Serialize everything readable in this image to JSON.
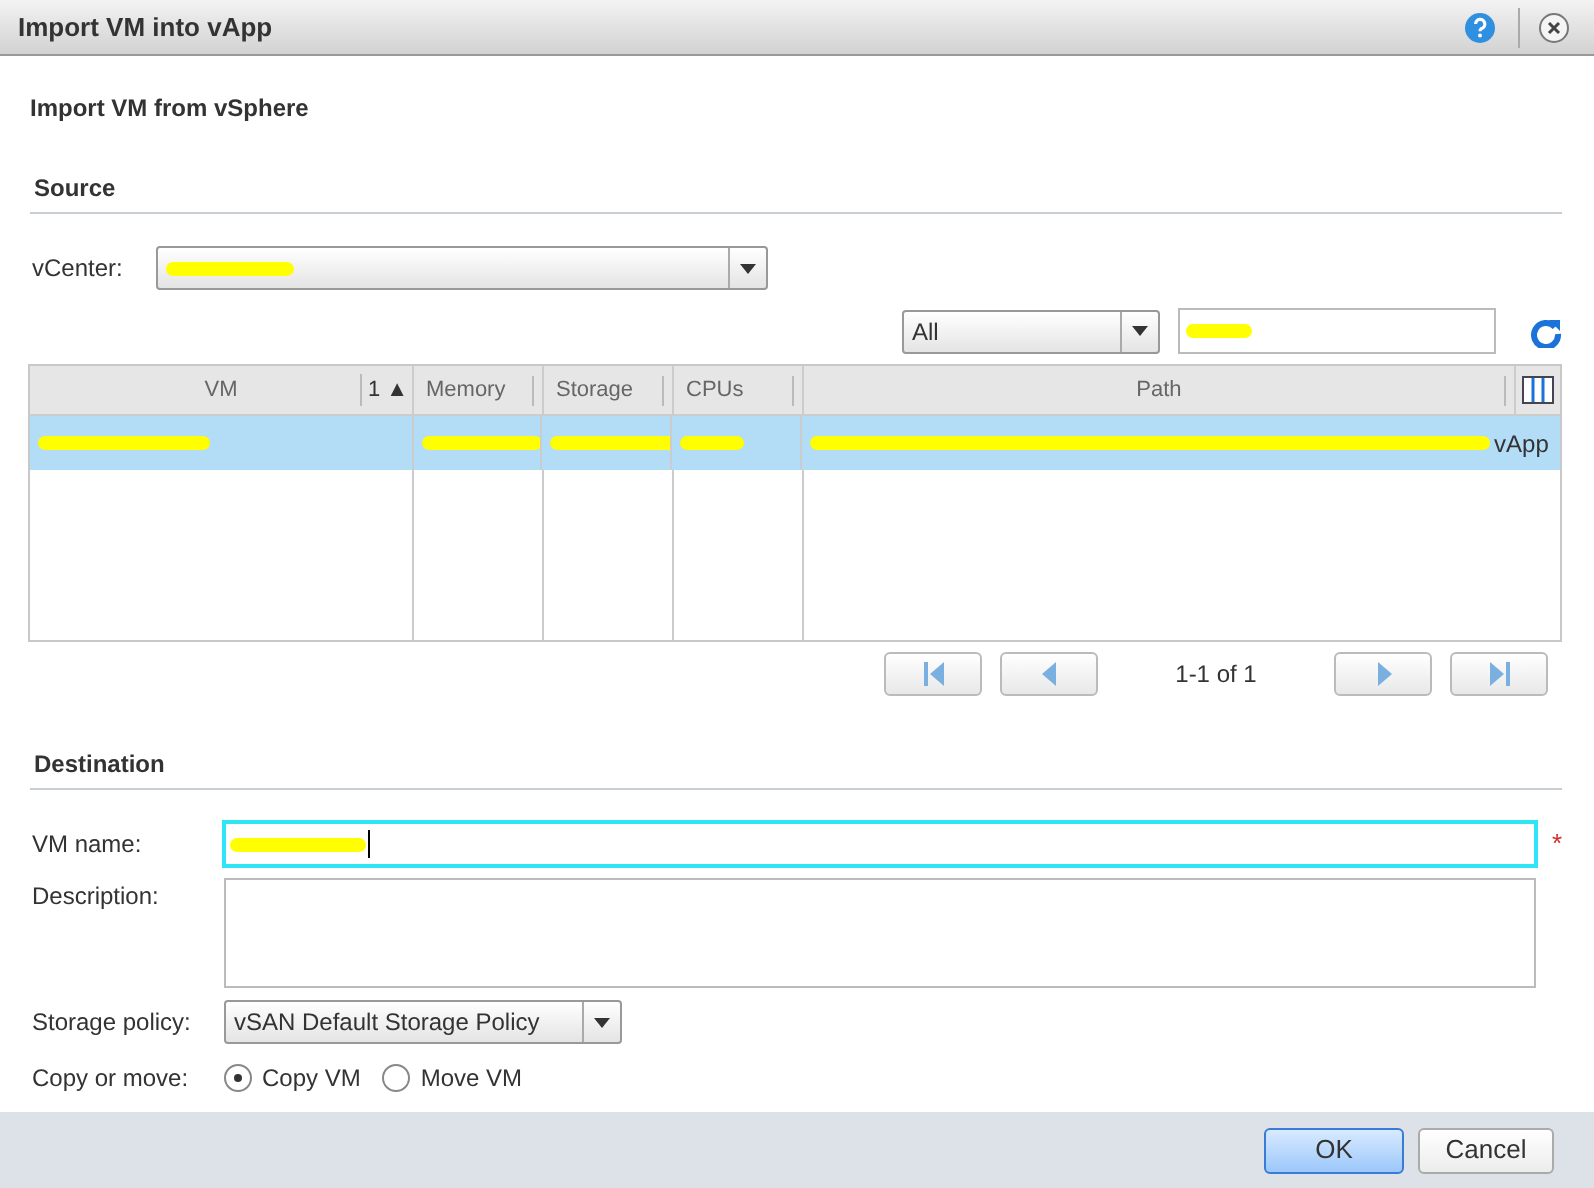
{
  "window": {
    "title": "Import VM into vApp"
  },
  "heading": "Import VM from vSphere",
  "source": {
    "title": "Source",
    "vcenter": {
      "label": "vCenter:",
      "redacted": true
    },
    "filter": {
      "value": "All",
      "search_redacted": true
    },
    "table": {
      "columns": [
        {
          "label": "VM",
          "sort": "1 ▲"
        },
        {
          "label": "Memory"
        },
        {
          "label": "Storage"
        },
        {
          "label": "CPUs"
        },
        {
          "label": "Path"
        }
      ],
      "rows": [
        {
          "selected": true,
          "cells": [
            {
              "redacted": true
            },
            {
              "redacted": true
            },
            {
              "redacted": true
            },
            {
              "redacted": true
            },
            {
              "redacted": true,
              "text": "vApp"
            }
          ]
        }
      ]
    },
    "pager": "1-1 of 1"
  },
  "destination": {
    "title": "Destination",
    "vm_name": {
      "label": "VM name:",
      "redacted": true,
      "required_mark": "*"
    },
    "description": {
      "label": "Description:"
    },
    "storage_policy": {
      "label": "Storage policy:",
      "value": "vSAN Default Storage Policy"
    },
    "copy_or_move": {
      "label": "Copy or move:",
      "options": [
        {
          "label": "Copy VM",
          "selected": true
        },
        {
          "label": "Move VM",
          "selected": false
        }
      ]
    }
  },
  "buttons": [
    {
      "label": "OK",
      "primary": true
    },
    {
      "label": "Cancel",
      "primary": false
    }
  ]
}
